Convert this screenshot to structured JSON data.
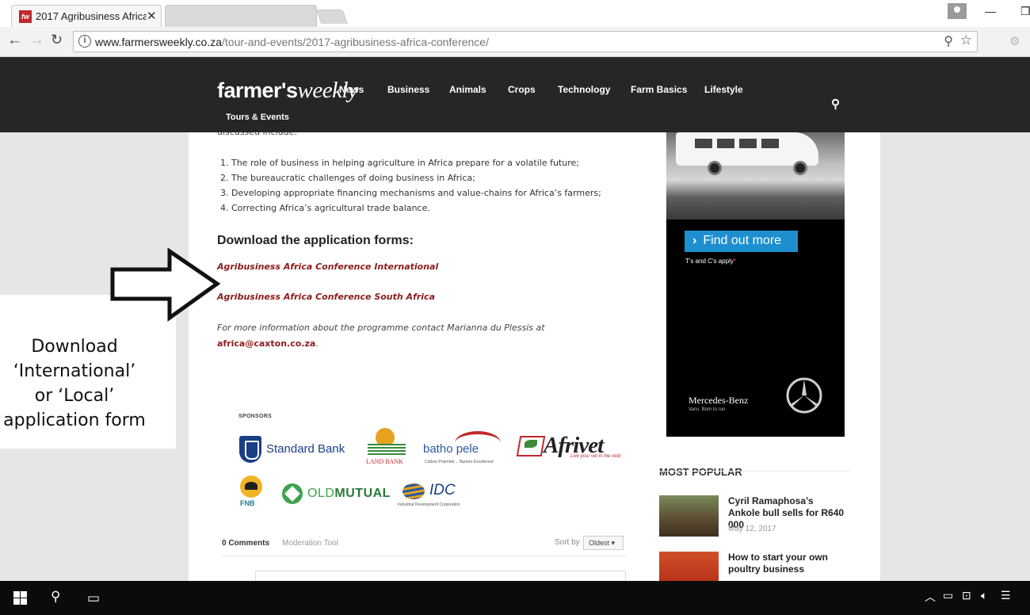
{
  "browser": {
    "active_tab_title": "2017 Agribusiness Africa",
    "favicon_text": "fw",
    "url_domain": "www.farmersweekly.co.za",
    "url_path": "/tour-and-events/2017-agribusiness-africa-conference/"
  },
  "site": {
    "logo_part1": "farmer's",
    "logo_part2": "weekly",
    "menu": [
      "News",
      "Business",
      "Animals",
      "Crops",
      "Technology",
      "Farm Basics",
      "Lifestyle"
    ],
    "menu_second_row": "Tours & Events"
  },
  "article": {
    "intro_tail": "discussed include:",
    "topics": [
      "1. The role of business in helping agriculture in Africa prepare for a volatile future;",
      "2. The bureaucratic challenges of doing business in Africa;",
      "3. Developing appropriate financing mechanisms and value-chains for Africa’s farmers;",
      "4. Correcting Africa’s agricultural trade balance."
    ],
    "download_heading": "Download the application forms:",
    "link_international": "Agribusiness Africa Conference International",
    "link_south_africa": "Agribusiness Africa Conference South Africa",
    "contact_text": "For more information about the programme contact Marianna du Plessis at",
    "contact_email": "africa@caxton.co.za",
    "contact_period": "."
  },
  "sponsors": {
    "label": "SPONSORS",
    "standard_bank": "Standard Bank",
    "land_bank": "LAND BANK",
    "batho_pele": "batho pele",
    "batho_pele_sub": "Culture Potential ... Nurture Excellence!",
    "afrivet": "Afrivet",
    "afrivet_sub": "Live your vet in the veld",
    "fnb": "FNB",
    "old_mutual_a": "OLD",
    "old_mutual_b": "MUTUAL",
    "idc": "IDC",
    "idc_sub": "Industrial Development Corporation"
  },
  "comments": {
    "count_label": "0 Comments",
    "moderation_label": "Moderation Tool",
    "sort_label": "Sort by",
    "sort_value": "Oldest"
  },
  "ad": {
    "cta": "Find out more",
    "terms": "T's and C's apply",
    "terms_mark": "*",
    "brand": "Mercedes-Benz",
    "tagline": "Vans. Born to run."
  },
  "popular": {
    "title": "MOST POPULAR",
    "items": [
      {
        "title": "Cyril Ramaphosa’s Ankole bull sells for R640 000",
        "date": "May 12, 2017"
      },
      {
        "title": "How to start your own poultry business",
        "date": ""
      }
    ]
  },
  "annotation": {
    "lines": [
      "Download",
      "‘International’",
      "or ‘Local’",
      "application form"
    ]
  },
  "colors": {
    "link_red": "#8b1d1d",
    "header_dark": "#262626",
    "cta_blue": "#1d8fd1"
  }
}
